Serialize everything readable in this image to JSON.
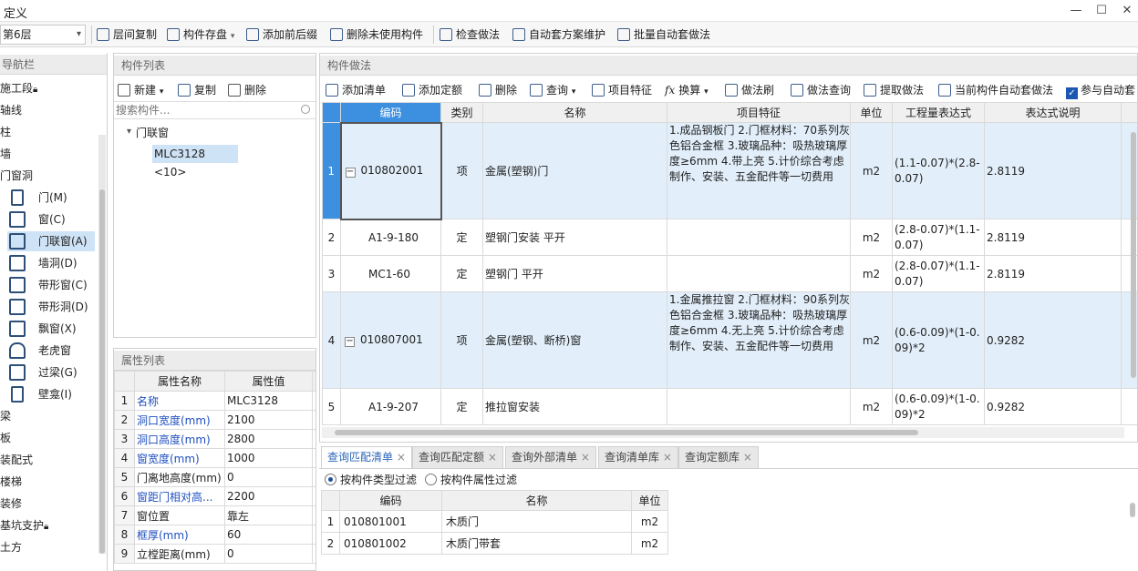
{
  "window": {
    "title": "定义",
    "minimize": "—",
    "maximize": "☐",
    "close": "✕"
  },
  "toolbar": {
    "floor": "第6层",
    "floor_arrow": "▾",
    "items": [
      "层间复制",
      "构件存盘",
      "添加前后缀",
      "删除未使用构件",
      "检查做法",
      "自动套方案维护",
      "批量自动套做法"
    ],
    "dropdown": "▾"
  },
  "nav": {
    "header": "导航栏",
    "items_top": [
      "施工段",
      "轴线",
      "柱",
      "墙",
      "门窗洞"
    ],
    "sub": [
      "门(M)",
      "窗(C)",
      "门联窗(A)",
      "墙洞(D)",
      "带形窗(C)",
      "带形洞(D)",
      "飘窗(X)",
      "老虎窗",
      "过梁(G)",
      "壁龛(I)"
    ],
    "items_bottom": [
      "梁",
      "板",
      "装配式",
      "楼梯",
      "装修",
      "基坑支护",
      "土方"
    ]
  },
  "component_list": {
    "header": "构件列表",
    "new": "新建",
    "copy": "复制",
    "delete": "删除",
    "dropdown": "▾",
    "search_placeholder": "搜索构件...",
    "tree_arrow": "▾",
    "group": "门联窗",
    "item": "MLC3128 <10>"
  },
  "properties": {
    "header": "属性列表",
    "col_name": "属性名称",
    "col_value": "属性值",
    "rows": [
      {
        "n": "1",
        "name": "名称",
        "value": "MLC3128",
        "blue": true
      },
      {
        "n": "2",
        "name": "洞口宽度(mm)",
        "value": "2100",
        "blue": true
      },
      {
        "n": "3",
        "name": "洞口高度(mm)",
        "value": "2800",
        "blue": true
      },
      {
        "n": "4",
        "name": "窗宽度(mm)",
        "value": "1000",
        "blue": true
      },
      {
        "n": "5",
        "name": "门离地高度(mm)",
        "value": "0",
        "blue": false
      },
      {
        "n": "6",
        "name": "窗距门相对高...",
        "value": "2200",
        "blue": true
      },
      {
        "n": "7",
        "name": "窗位置",
        "value": "靠左",
        "blue": false
      },
      {
        "n": "8",
        "name": "框厚(mm)",
        "value": "60",
        "blue": true
      },
      {
        "n": "9",
        "name": "立樘距离(mm)",
        "value": "0",
        "blue": false
      }
    ]
  },
  "method": {
    "header": "构件做法",
    "toolbar": [
      "添加清单",
      "添加定额",
      "删除",
      "查询",
      "项目特征",
      "换算",
      "做法刷",
      "做法查询",
      "提取做法",
      "当前构件自动套做法",
      "参与自动套"
    ],
    "dropdown": "▾",
    "cols": [
      "编码",
      "类别",
      "名称",
      "项目特征",
      "单位",
      "工程量表达式",
      "表达式说明"
    ],
    "rows": [
      {
        "n": "1",
        "code": "010802001",
        "type": "项",
        "name": "金属(塑钢)门",
        "feature": "1.成品钢板门\n2.门框材料：70系列灰色铝合金框\n3.玻璃品种：吸热玻璃厚度≥6mm\n4.带上亮\n5.计价综合考虑制作、安装、五金配件等一切费用",
        "unit": "m2",
        "expr": "(1.1-0.07)*(2.8-0.07)",
        "desc": "2.8119",
        "group": true
      },
      {
        "n": "2",
        "code": "A1-9-180",
        "type": "定",
        "name": "塑钢门安装 平开",
        "feature": "",
        "unit": "m2",
        "expr": "(2.8-0.07)*(1.1-0.07)",
        "desc": "2.8119",
        "group": false
      },
      {
        "n": "3",
        "code": "MC1-60",
        "type": "定",
        "name": "塑钢门 平开",
        "feature": "",
        "unit": "m2",
        "expr": "(2.8-0.07)*(1.1-0.07)",
        "desc": "2.8119",
        "group": false
      },
      {
        "n": "4",
        "code": "010807001",
        "type": "项",
        "name": "金属(塑钢、断桥)窗",
        "feature": "1.金属推拉窗\n2.门框材料：90系列灰色铝合金框\n3.玻璃品种：吸热玻璃厚度≥6mm\n4.无上亮\n5.计价综合考虑制作、安装、五金配件等一切费用",
        "unit": "m2",
        "expr": "(0.6-0.09)*(1-0.09)*2",
        "desc": "0.9282",
        "group": true
      },
      {
        "n": "5",
        "code": "A1-9-207",
        "type": "定",
        "name": "推拉窗安装",
        "feature": "",
        "unit": "m2",
        "expr": "(0.6-0.09)*(1-0.09)*2",
        "desc": "0.9282",
        "group": false
      }
    ]
  },
  "query": {
    "tabs": [
      "查询匹配清单",
      "查询匹配定额",
      "查询外部清单",
      "查询清单库",
      "查询定额库"
    ],
    "tab_close": "×",
    "radio1": "按构件类型过滤",
    "radio2": "按构件属性过滤",
    "cols": [
      "编码",
      "名称",
      "单位"
    ],
    "rows": [
      {
        "n": "1",
        "code": "010801001",
        "name": "木质门",
        "unit": "m2"
      },
      {
        "n": "2",
        "code": "010801002",
        "name": "木质门带套",
        "unit": "m2"
      }
    ]
  }
}
